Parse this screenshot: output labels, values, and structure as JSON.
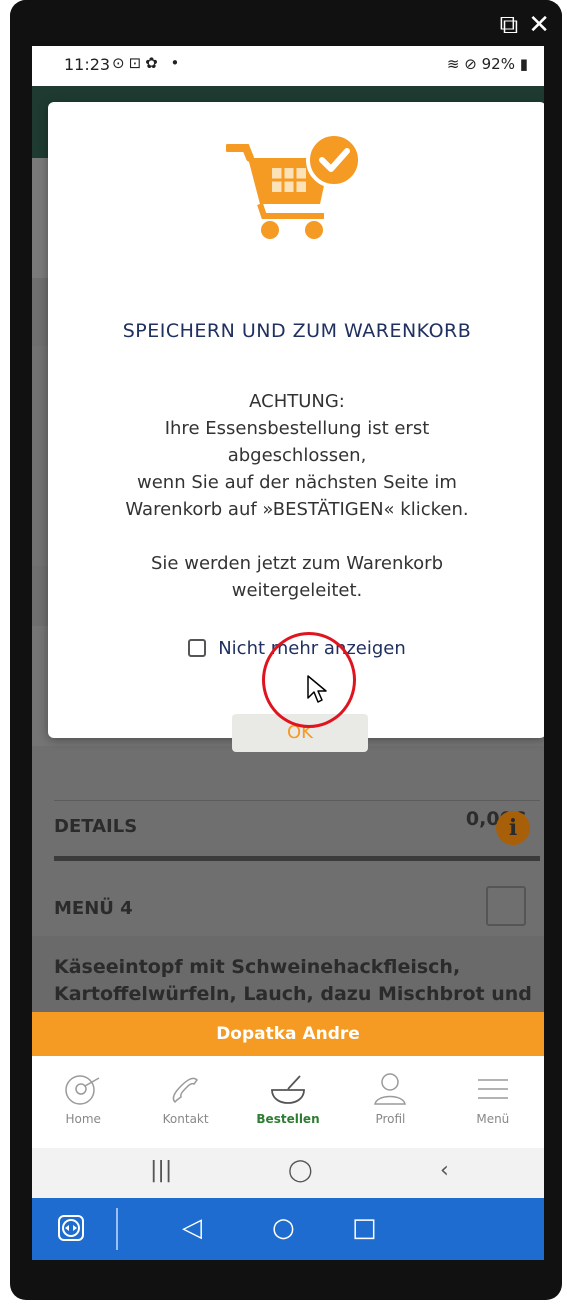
{
  "window": {
    "icons": [
      "external-link-icon",
      "close-icon"
    ]
  },
  "status_bar": {
    "time": "11:23",
    "left_icons": "⊙⊡✿ •",
    "battery": "92%"
  },
  "background": {
    "price": "0,00€",
    "details_label": "DETAILS",
    "menu_label": "MENÜ 4",
    "dish_text": "Käseeintopf mit Schweinehackfleisch, Kartoffelwürfeln, Lauch, dazu Mischbrot und"
  },
  "modal": {
    "title": "SPEICHERN UND ZUM WARENKORB",
    "warning_heading": "ACHTUNG:",
    "warning_lines": [
      "Ihre Essensbestellung ist erst",
      "abgeschlossen,",
      "wenn Sie auf der nächsten Seite im",
      "Warenkorb auf »BESTÄTIGEN« klicken."
    ],
    "redirect_lines": [
      "Sie werden jetzt zum Warenkorb",
      "weitergeleitet."
    ],
    "checkbox_label": "Nicht mehr anzeigen",
    "ok_label": "OK",
    "accent_color": "#f59a23"
  },
  "user_bar": {
    "name": "Dopatka Andre"
  },
  "bottom_nav": {
    "items": [
      {
        "label": "Home",
        "icon": "home-cooking-icon"
      },
      {
        "label": "Kontakt",
        "icon": "phone-icon"
      },
      {
        "label": "Bestellen",
        "icon": "bowl-icon",
        "active": true
      },
      {
        "label": "Profil",
        "icon": "profile-icon"
      },
      {
        "label": "Menü",
        "icon": "hamburger-menu-icon"
      }
    ]
  },
  "android_nav": {
    "recent": "|||",
    "home": "◯",
    "back": "‹"
  },
  "teamviewer_bar": {
    "back": "◁",
    "home": "○",
    "recent": "□"
  }
}
